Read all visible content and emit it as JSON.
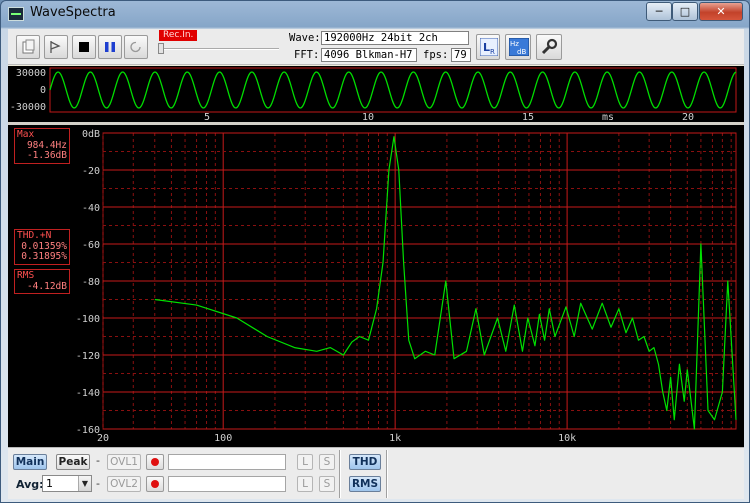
{
  "window": {
    "title": "WaveSpectra"
  },
  "toolbar": {
    "rec_badge": "Rec.In.",
    "wave_label": "Wave:",
    "wave_value": "192000Hz 24bit 2ch",
    "fft_label": "FFT:",
    "fft_value": "4096 Blkman-H7",
    "fps_label": "fps:",
    "fps_value": "79"
  },
  "scope": {
    "y_ticks": [
      "30000",
      "0",
      "-30000"
    ],
    "x_ticks": [
      "5",
      "10",
      "15",
      "20"
    ],
    "x_unit": "ms"
  },
  "readouts": {
    "max_label": "Max",
    "max_freq": "984.4Hz",
    "max_level": "-1.36dB",
    "thd_label": "THD.+N",
    "thd_value1": "0.01359%",
    "thd_value2": "0.31895%",
    "rms_label": "RMS",
    "rms_value": "-4.12dB"
  },
  "chart_data": {
    "type": "line",
    "x_scale": "log",
    "xlim": [
      20,
      96000
    ],
    "ylim": [
      -160,
      0
    ],
    "x_ticks": [
      "20",
      "100",
      "1k",
      "10k"
    ],
    "y_ticks": [
      "0dB",
      "-20",
      "-40",
      "-60",
      "-80",
      "-100",
      "-120",
      "-140",
      "-160"
    ],
    "grid": true,
    "series": [
      {
        "color": "#00e000",
        "x": [
          40,
          70,
          120,
          180,
          260,
          350,
          420,
          500,
          560,
          620,
          700,
          780,
          850,
          920,
          984,
          1050,
          1120,
          1200,
          1300,
          1500,
          1700,
          1970,
          2200,
          2600,
          2950,
          3300,
          3940,
          4400,
          4930,
          5500,
          5910,
          6500,
          6900,
          7400,
          7880,
          8500,
          9850,
          11000,
          12000,
          14000,
          16000,
          18000,
          20000,
          22000,
          24000,
          26000,
          28000,
          30000,
          32000,
          34000,
          36000,
          38000,
          40000,
          42000,
          45000,
          48000,
          50000,
          55000,
          60000,
          66000,
          72000,
          80000,
          86000,
          96000
        ],
        "y": [
          -90,
          -93,
          -100,
          -110,
          -116,
          -118,
          -116,
          -120,
          -113,
          -110,
          -112,
          -95,
          -70,
          -20,
          -2,
          -20,
          -70,
          -112,
          -122,
          -118,
          -120,
          -80,
          -122,
          -118,
          -95,
          -120,
          -100,
          -118,
          -93,
          -118,
          -100,
          -115,
          -98,
          -112,
          -95,
          -110,
          -94,
          -110,
          -92,
          -106,
          -92,
          -105,
          -95,
          -108,
          -100,
          -112,
          -110,
          -118,
          -116,
          -125,
          -140,
          -150,
          -132,
          -155,
          -125,
          -145,
          -128,
          -160,
          -60,
          -150,
          -155,
          -140,
          -80,
          -155
        ]
      }
    ]
  },
  "bottom": {
    "main_label": "Main",
    "peak_label": "Peak",
    "ovl1_label": "OVL1",
    "ovl2_label": "OVL2",
    "l_label": "L",
    "s_label": "S",
    "thd_label": "THD",
    "rms_label": "RMS",
    "avg_label": "Avg:",
    "avg_value": "1",
    "dash": "-"
  }
}
